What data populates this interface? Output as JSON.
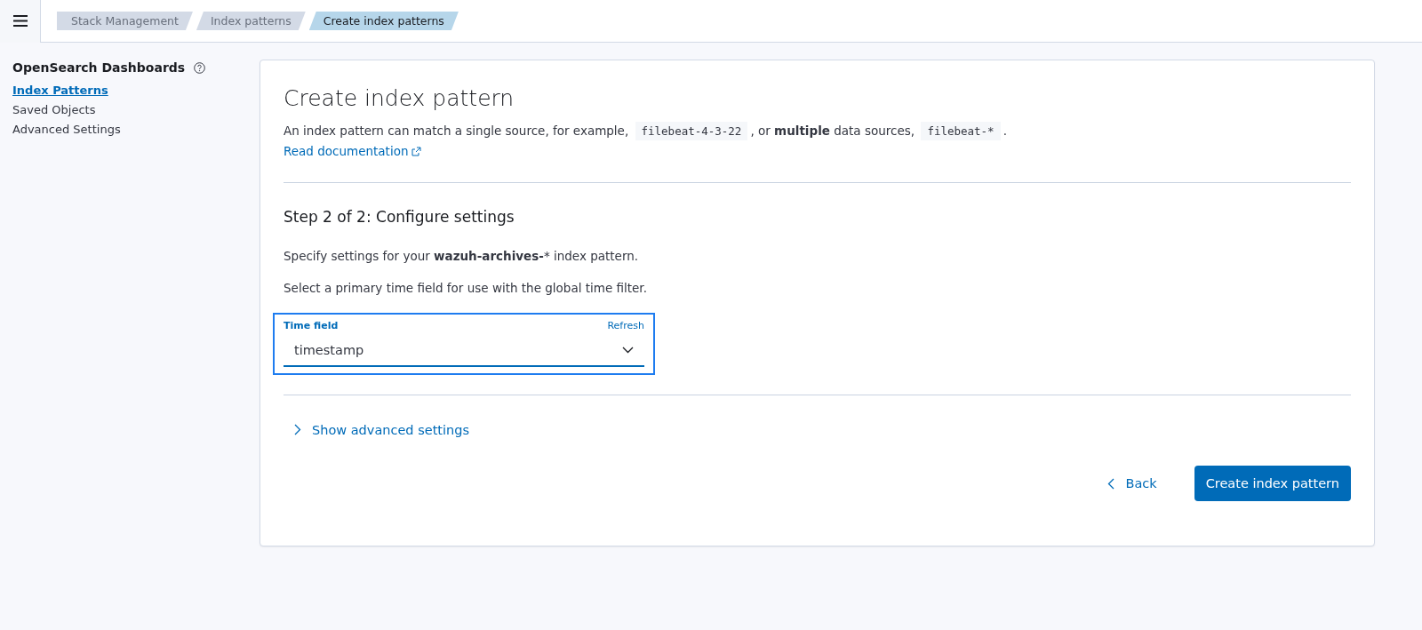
{
  "breadcrumbs": [
    {
      "label": "Stack Management",
      "selected": false
    },
    {
      "label": "Index patterns",
      "selected": false
    },
    {
      "label": "Create index patterns",
      "selected": true
    }
  ],
  "sidebar": {
    "title": "OpenSearch Dashboards",
    "items": [
      {
        "label": "Index Patterns",
        "selected": true
      },
      {
        "label": "Saved Objects",
        "selected": false
      },
      {
        "label": "Advanced Settings",
        "selected": false
      }
    ]
  },
  "panel": {
    "title": "Create index pattern",
    "description": [
      {
        "kind": "text",
        "text": "An index pattern can match a single source, for example, "
      },
      {
        "kind": "code",
        "text": "filebeat-4-3-22"
      },
      {
        "kind": "text",
        "text": ", or **multiple** data sources, "
      },
      {
        "kind": "code",
        "text": "filebeat-*"
      },
      {
        "kind": "text",
        "text": "."
      }
    ],
    "doc_link": "Read documentation",
    "step_title": "Step 2 of 2: Configure settings",
    "step_text": "Specify settings for your **wazuh-archives-*** index pattern.",
    "time_hint": "Select a primary time field for use with the global time filter.",
    "time_field": {
      "label": "Time field",
      "action": "Refresh",
      "value": "timestamp",
      "focused": true
    },
    "advanced_toggle": {
      "label": "Show advanced settings",
      "expanded": false
    },
    "back_button": "Back",
    "create_button": "Create index pattern"
  }
}
